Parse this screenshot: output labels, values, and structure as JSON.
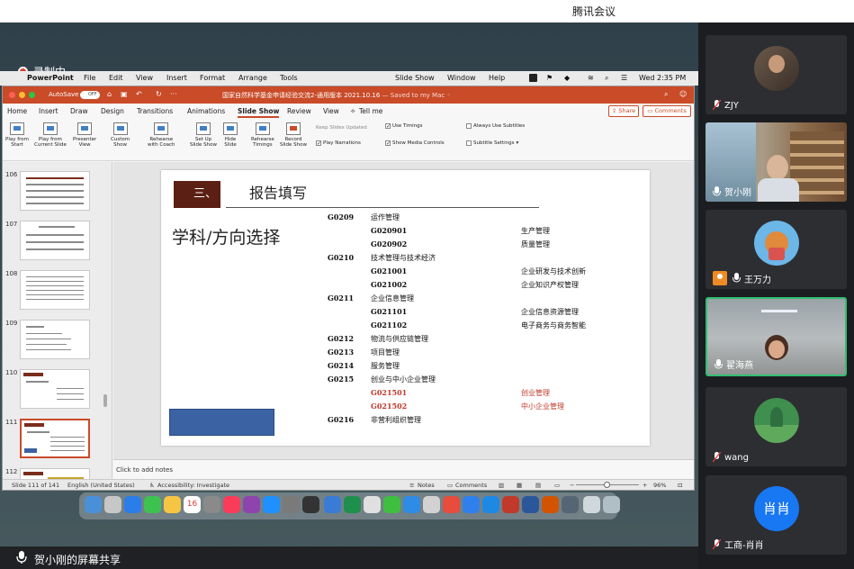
{
  "meeting": {
    "app_title": "腾讯会议",
    "recording_label": "录制中",
    "share_label": "贺小刚的屏幕共享"
  },
  "mac_menu": {
    "items": [
      "PowerPoint",
      "File",
      "Edit",
      "View",
      "Insert",
      "Format",
      "Arrange",
      "Tools",
      "Slide Show",
      "Window",
      "Help"
    ],
    "clock": "Wed  2:35 PM"
  },
  "ppt": {
    "autosave_label": "AutoSave",
    "autosave_state": "OFF",
    "doc_title": "国家自然科学基金申请经验交流2-通用版本 2021.10.16",
    "saved_status": "— Saved to my Mac ◦",
    "tabs": [
      "Home",
      "Insert",
      "Draw",
      "Design",
      "Transitions",
      "Animations",
      "Slide Show",
      "Review",
      "View",
      "Tell me"
    ],
    "active_tab": "Slide Show",
    "share_label": "Share",
    "comments_label": "Comments",
    "ribbon": {
      "play_from_start": [
        "Play from",
        "Start"
      ],
      "play_from_current": [
        "Play from",
        "Current Slide"
      ],
      "presenter_view": [
        "Presenter",
        "View"
      ],
      "custom_show": [
        "Custom",
        "Show"
      ],
      "rehearse_coach": [
        "Rehearse",
        "with Coach"
      ],
      "set_up": [
        "Set Up",
        "Slide Show"
      ],
      "hide_slide": [
        "Hide",
        "Slide"
      ],
      "rehearse_timings": [
        "Rehearse",
        "Timings"
      ],
      "record_show": [
        "Record",
        "Slide Show"
      ],
      "keep_slides_updated": "Keep Slides Updated",
      "use_timings": "Use Timings",
      "play_narrations": "Play Narrations",
      "show_media_controls": "Show Media Controls",
      "always_use_subtitles": "Always Use Subtitles",
      "subtitle_settings": "Subtitle Settings"
    },
    "thumbnails": [
      "106",
      "107",
      "108",
      "109",
      "110",
      "111",
      "112"
    ],
    "active_slide": "111",
    "slide": {
      "section_number": "三、",
      "section_title": "报告填写",
      "subject_label": "学科/方向选择",
      "rows": [
        {
          "code": "G0209",
          "name": "运作管理",
          "sub_code": "",
          "sub_name": "",
          "red": false
        },
        {
          "code": "",
          "name": "",
          "sub_code": "G020901",
          "sub_name": "生产管理",
          "red": false
        },
        {
          "code": "",
          "name": "",
          "sub_code": "G020902",
          "sub_name": "质量管理",
          "red": false
        },
        {
          "code": "G0210",
          "name": "技术管理与技术经济",
          "sub_code": "",
          "sub_name": "",
          "red": false
        },
        {
          "code": "",
          "name": "",
          "sub_code": "G021001",
          "sub_name": "企业研发与技术创新",
          "red": false
        },
        {
          "code": "",
          "name": "",
          "sub_code": "G021002",
          "sub_name": "企业知识产权管理",
          "red": false
        },
        {
          "code": "G0211",
          "name": "企业信息管理",
          "sub_code": "",
          "sub_name": "",
          "red": false
        },
        {
          "code": "",
          "name": "",
          "sub_code": "G021101",
          "sub_name": "企业信息资源管理",
          "red": false
        },
        {
          "code": "",
          "name": "",
          "sub_code": "G021102",
          "sub_name": "电子商务与商务智能",
          "red": false
        },
        {
          "code": "G0212",
          "name": "物流与供应链管理",
          "sub_code": "",
          "sub_name": "",
          "red": false
        },
        {
          "code": "G0213",
          "name": "项目管理",
          "sub_code": "",
          "sub_name": "",
          "red": false
        },
        {
          "code": "G0214",
          "name": "服务管理",
          "sub_code": "",
          "sub_name": "",
          "red": false
        },
        {
          "code": "G0215",
          "name": "创业与中小企业管理",
          "sub_code": "",
          "sub_name": "",
          "red": false
        },
        {
          "code": "",
          "name": "",
          "sub_code": "G021501",
          "sub_name": "创业管理",
          "red": true
        },
        {
          "code": "",
          "name": "",
          "sub_code": "G021502",
          "sub_name": "中小企业管理",
          "red": true
        },
        {
          "code": "G0216",
          "name": "非营利组织管理",
          "sub_code": "",
          "sub_name": "",
          "red": false
        }
      ]
    },
    "notes_placeholder": "Click to add notes",
    "status": {
      "slide_counter": "Slide 111 of 141",
      "language": "English (United States)",
      "accessibility": "Accessibility: Investigate",
      "notes": "Notes",
      "comments": "Comments",
      "zoom": "96%"
    }
  },
  "participants": [
    {
      "name": "ZJY",
      "muted": true
    },
    {
      "name": "贺小刚",
      "muted": false
    },
    {
      "name": "王万力",
      "muted": false
    },
    {
      "name": "翟海燕",
      "muted": false
    },
    {
      "name": "wang",
      "muted": true
    },
    {
      "name": "工商-肖肖",
      "muted": true,
      "avatar_text": "肖肖"
    }
  ],
  "colors": {
    "ppt_accent": "#c94b28",
    "section_box": "#5b1f14",
    "highlight_red": "#c0392b",
    "speaking": "#2fbf71",
    "avatar_blue": "#1877f2"
  }
}
